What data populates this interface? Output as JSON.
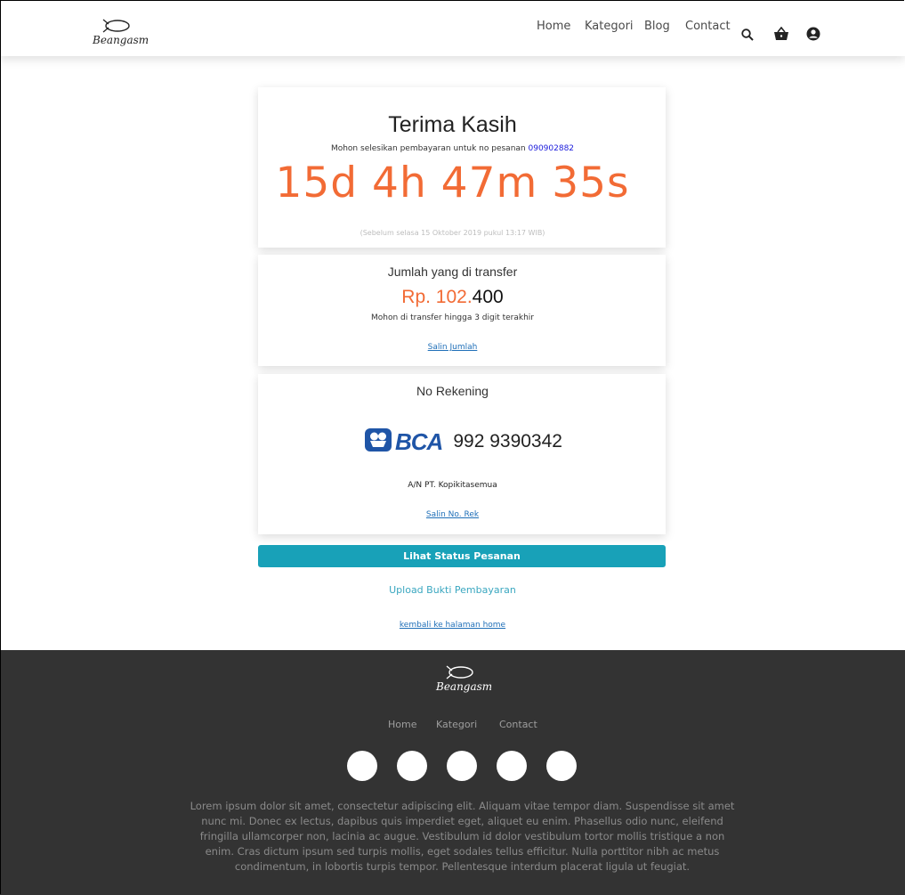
{
  "brand": {
    "logo_text": "Beangasm"
  },
  "nav": {
    "items": [
      "Home",
      "Kategori",
      "Blog",
      "Contact"
    ],
    "icons": [
      "search-icon",
      "basket-icon",
      "user-icon"
    ]
  },
  "payment": {
    "title": "Terima Kasih",
    "instruction_prefix": "Mohon selesikan pembayaran untuk no pesanan",
    "order_number": "090902882",
    "countdown": "15d 4h 47m 35s",
    "deadline": "(Sebelum selasa 15 Oktober 2019 pukul 13:17 WIB)"
  },
  "transfer": {
    "label": "Jumlah yang di transfer",
    "amount_main": "Rp. 102.",
    "amount_last": "400",
    "note": "Mohon di transfer hingga 3 digit terakhir",
    "copy_link": "Salin Jumlah"
  },
  "account": {
    "label": "No Rekening",
    "bank": "BCA",
    "number": "992 9390342",
    "holder": "A/N PT. Kopikitasemua",
    "copy_link": "Salin No. Rek"
  },
  "actions": {
    "status_button": "Lihat Status Pesanan",
    "upload_link": "Upload Bukti Pembayaran",
    "back_link": "kembali ke halaman home"
  },
  "footer": {
    "nav": [
      "Home",
      "Kategori",
      "Contact"
    ],
    "lorem": "Lorem ipsum dolor sit amet, consectetur adipiscing elit. Aliquam vitae tempor diam. Suspendisse sit amet nunc mi. Donec ex lectus, dapibus quis imperdiet eget, aliquet eu enim. Phasellus odio nunc, eleifend fringilla ullamcorper non, lacinia ac augue. Vestibulum id dolor vestibulum tortor mollis tristique a non enim. Cras dictum ipsum sed turpis mollis, eget sodales tellus efficitur. Nulla porttitor nibh ac metus condimentum, in lobortis turpis tempor. Pellentesque interdum placerat ligula ut feugiat."
  },
  "colors": {
    "accent_orange": "#f26b35",
    "button_teal": "#18a1b8",
    "footer_bg": "#333333",
    "bca_blue": "#1f55a7"
  }
}
